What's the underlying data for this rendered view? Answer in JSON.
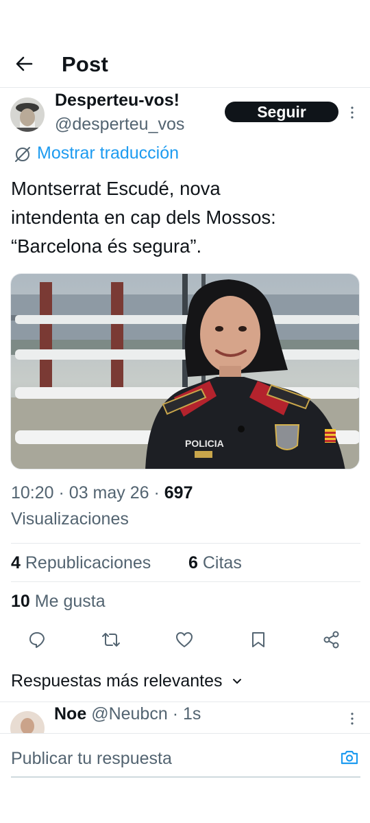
{
  "header": {
    "title": "Post"
  },
  "post": {
    "author_name": "Desperteu-vos!",
    "author_handle": "@desperteu_vos",
    "follow_label": "Seguir",
    "translate_label": "Mostrar traducción",
    "text_lines": [
      "Montserrat Escudé, nova",
      "intendenta en cap dels Mossos:",
      "“Barcelona és segura”."
    ],
    "image": {
      "uniform_label": "POLICIA"
    },
    "time": "10:20",
    "date": "03 may 26",
    "views_count": "697",
    "views_label": "Visualizaciones",
    "reposts_count": "4",
    "reposts_label": "Republicaciones",
    "quotes_count": "6",
    "quotes_label": "Citas",
    "likes_count": "10",
    "likes_label": "Me gusta"
  },
  "actions": {
    "icons": [
      "reply-icon",
      "repost-icon",
      "like-icon",
      "bookmark-icon",
      "share-icon"
    ]
  },
  "replies": {
    "sort_label": "Respuestas más relevantes",
    "first": {
      "name": "Noe",
      "handle": "@Neubcn",
      "age": "1s"
    }
  },
  "composer": {
    "placeholder": "Publicar tu respuesta"
  },
  "colors": {
    "accent": "#1d9bf0",
    "text": "#0f1419",
    "muted": "#536471",
    "divider": "#e6e9ec"
  }
}
